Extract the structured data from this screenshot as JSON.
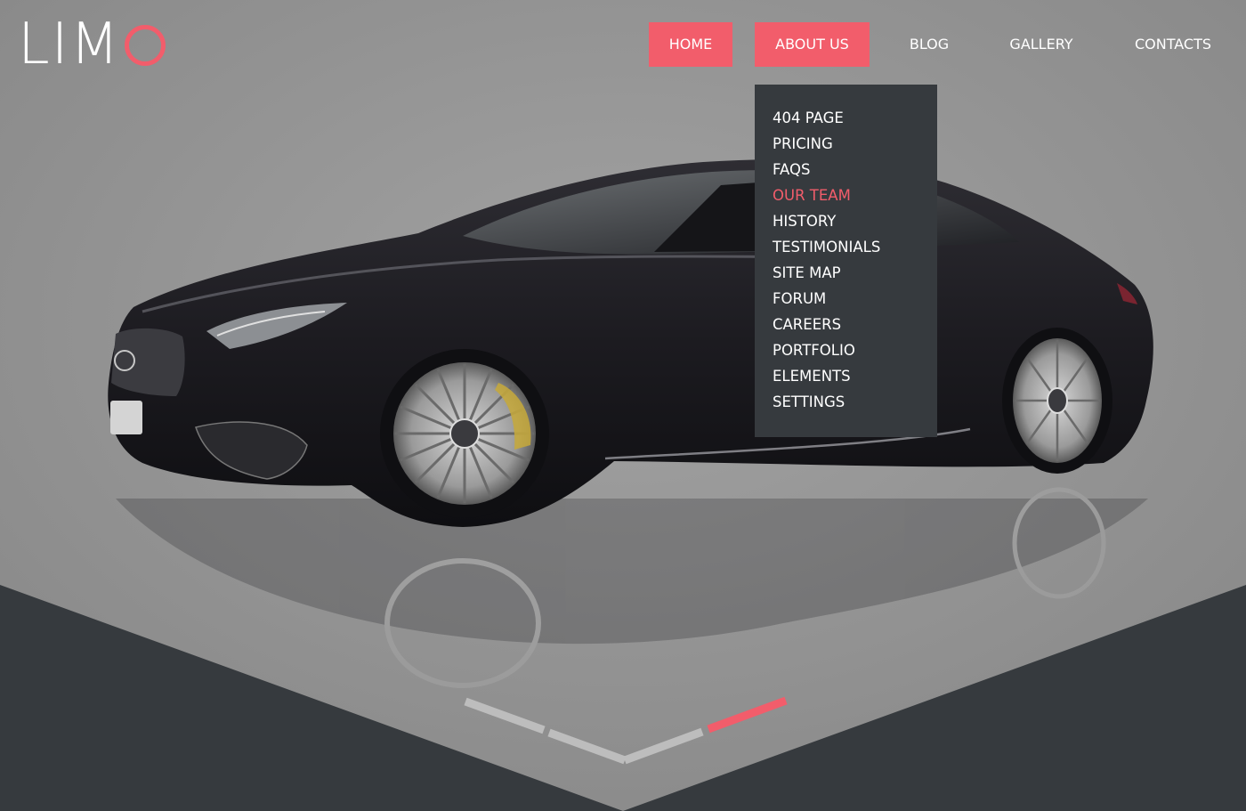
{
  "brand": {
    "logo_text": "LIM",
    "logo_accent_letter": "O",
    "accent_color": "#f25d6b"
  },
  "nav": {
    "items": [
      {
        "label": "HOME",
        "active": true
      },
      {
        "label": "ABOUT US",
        "active": true
      },
      {
        "label": "BLOG",
        "active": false
      },
      {
        "label": "GALLERY",
        "active": false
      },
      {
        "label": "CONTACTS",
        "active": false
      }
    ]
  },
  "dropdown": {
    "items": [
      {
        "label": "404 PAGE"
      },
      {
        "label": "PRICING"
      },
      {
        "label": "FAQS"
      },
      {
        "label": "OUR TEAM",
        "highlighted": true
      },
      {
        "label": "HISTORY"
      },
      {
        "label": "TESTIMONIALS"
      },
      {
        "label": "SITE MAP"
      },
      {
        "label": "FORUM"
      },
      {
        "label": "CAREERS"
      },
      {
        "label": "PORTFOLIO"
      },
      {
        "label": "ELEMENTS"
      },
      {
        "label": "SETTINGS"
      }
    ],
    "background_color": "#363a3e"
  },
  "hero": {
    "image": "black-sports-coupe",
    "bottom_panel_color": "#363a3e",
    "slider_indicator": {
      "slide_count": 4,
      "active_index": 3
    }
  }
}
